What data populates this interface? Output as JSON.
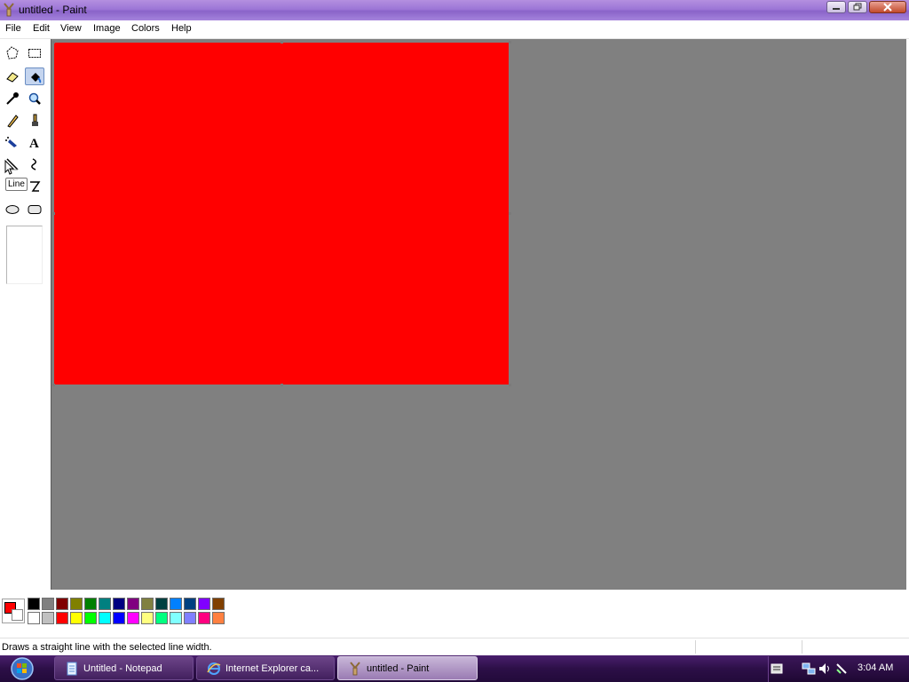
{
  "window": {
    "title": "untitled - Paint"
  },
  "menu": [
    "File",
    "Edit",
    "View",
    "Image",
    "Colors",
    "Help"
  ],
  "tools": [
    {
      "name": "free-form-select",
      "icon": "free-select-icon"
    },
    {
      "name": "select",
      "icon": "rect-select-icon"
    },
    {
      "name": "eraser",
      "icon": "eraser-icon"
    },
    {
      "name": "fill-with-color",
      "icon": "paint-bucket-icon"
    },
    {
      "name": "pick-color",
      "icon": "eyedropper-icon"
    },
    {
      "name": "magnifier",
      "icon": "magnifier-icon"
    },
    {
      "name": "pencil",
      "icon": "pencil-icon"
    },
    {
      "name": "brush",
      "icon": "brush-icon"
    },
    {
      "name": "airbrush",
      "icon": "airbrush-icon"
    },
    {
      "name": "text",
      "icon": "text-icon"
    },
    {
      "name": "line",
      "icon": "line-icon"
    },
    {
      "name": "curve",
      "icon": "curve-icon"
    },
    {
      "name": "rectangle",
      "icon": "rectangle-icon"
    },
    {
      "name": "polygon",
      "icon": "polygon-icon"
    },
    {
      "name": "ellipse",
      "icon": "ellipse-icon"
    },
    {
      "name": "rounded-rectangle",
      "icon": "rounded-rect-icon"
    }
  ],
  "active_tool": "fill-with-color",
  "tooltip": "Line",
  "canvas": {
    "fill_color": "#ff0000"
  },
  "colors": {
    "foreground": "#ff0000",
    "background": "#ffffff",
    "palette_top": [
      "#000000",
      "#808080",
      "#800000",
      "#808000",
      "#008000",
      "#008080",
      "#000080",
      "#800080",
      "#808040",
      "#004040",
      "#0080ff",
      "#004080",
      "#8000ff",
      "#804000"
    ],
    "palette_bottom": [
      "#ffffff",
      "#c0c0c0",
      "#ff0000",
      "#ffff00",
      "#00ff00",
      "#00ffff",
      "#0000ff",
      "#ff00ff",
      "#ffff80",
      "#00ff80",
      "#80ffff",
      "#8080ff",
      "#ff0080",
      "#ff8040"
    ]
  },
  "status": {
    "text": "Draws a straight line with the selected line width."
  },
  "taskbar": {
    "items": [
      {
        "label": "Untitled - Notepad",
        "icon": "notepad-icon",
        "active": false
      },
      {
        "label": "Internet Explorer ca...",
        "icon": "internet-explorer-icon",
        "active": false
      },
      {
        "label": "untitled - Paint",
        "icon": "paint-icon",
        "active": true
      }
    ],
    "clock": "3:04 AM"
  }
}
